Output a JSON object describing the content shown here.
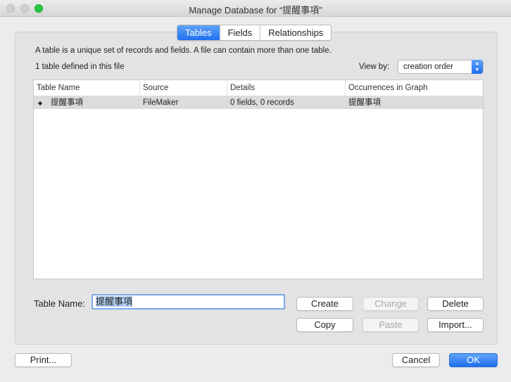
{
  "window": {
    "title": "Manage Database for “提醒事項”"
  },
  "tabs": [
    {
      "label": "Tables",
      "active": true
    },
    {
      "label": "Fields",
      "active": false
    },
    {
      "label": "Relationships",
      "active": false
    }
  ],
  "description": "A table is a unique set of records and fields. A file can contain more than one table.",
  "table_count": "1 table defined in this file",
  "view_by": {
    "label": "View by:",
    "value": "creation order"
  },
  "table": {
    "columns": [
      "Table Name",
      "Source",
      "Details",
      "Occurrences in Graph"
    ],
    "rows": [
      {
        "name": "提醒事項",
        "source": "FileMaker",
        "details": "0 fields, 0 records",
        "occurrences": "提醒事項"
      }
    ]
  },
  "table_name": {
    "label": "Table Name:",
    "value": "提醒事項"
  },
  "buttons": {
    "create": "Create",
    "change": "Change",
    "delete": "Delete",
    "copy": "Copy",
    "paste": "Paste",
    "import": "Import...",
    "print": "Print...",
    "cancel": "Cancel",
    "ok": "OK"
  },
  "colors": {
    "accent": "#1f6ff0",
    "selected_row": "#dcdcdc"
  },
  "icons": {
    "row_handle": "updown-arrows-icon",
    "select_arrows": "select-updown-icon"
  }
}
